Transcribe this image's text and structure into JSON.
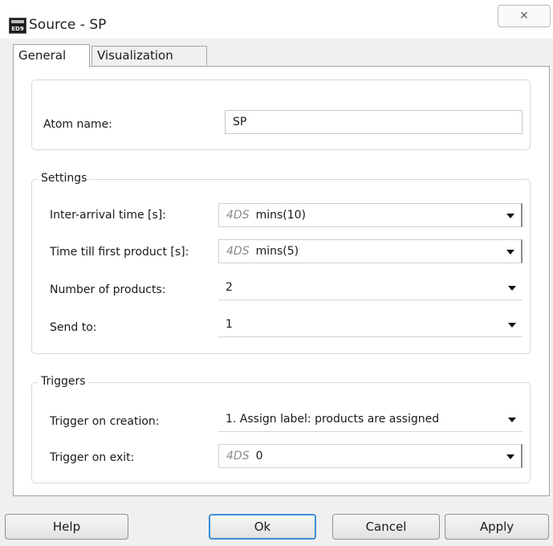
{
  "window": {
    "title": "Source - SP",
    "icon": "app-icon",
    "icon_text": "ED9",
    "close_icon": "close-icon"
  },
  "tabs": [
    {
      "label": "General",
      "active": true
    },
    {
      "label": "Visualization",
      "active": false
    }
  ],
  "atom": {
    "label": "Atom name:",
    "value": "SP"
  },
  "settings": {
    "title": "Settings",
    "inter_arrival": {
      "label": "Inter-arrival time [s]:",
      "prefix": "4DS",
      "value": "mins(10)"
    },
    "first_product": {
      "label": "Time till first product [s]:",
      "prefix": "4DS",
      "value": "mins(5)"
    },
    "num_products": {
      "label": "Number of products:",
      "value": "2"
    },
    "send_to": {
      "label": "Send to:",
      "value": "1"
    }
  },
  "triggers": {
    "title": "Triggers",
    "on_creation": {
      "label": "Trigger on creation:",
      "value": "1. Assign label: products are assigned"
    },
    "on_exit": {
      "label": "Trigger on exit:",
      "prefix": "4DS",
      "value": "0"
    }
  },
  "buttons": {
    "help": "Help",
    "ok": "Ok",
    "cancel": "Cancel",
    "apply": "Apply"
  },
  "colors": {
    "accent": "#3a8fd6",
    "dialog_bg": "#f0f0f0"
  }
}
